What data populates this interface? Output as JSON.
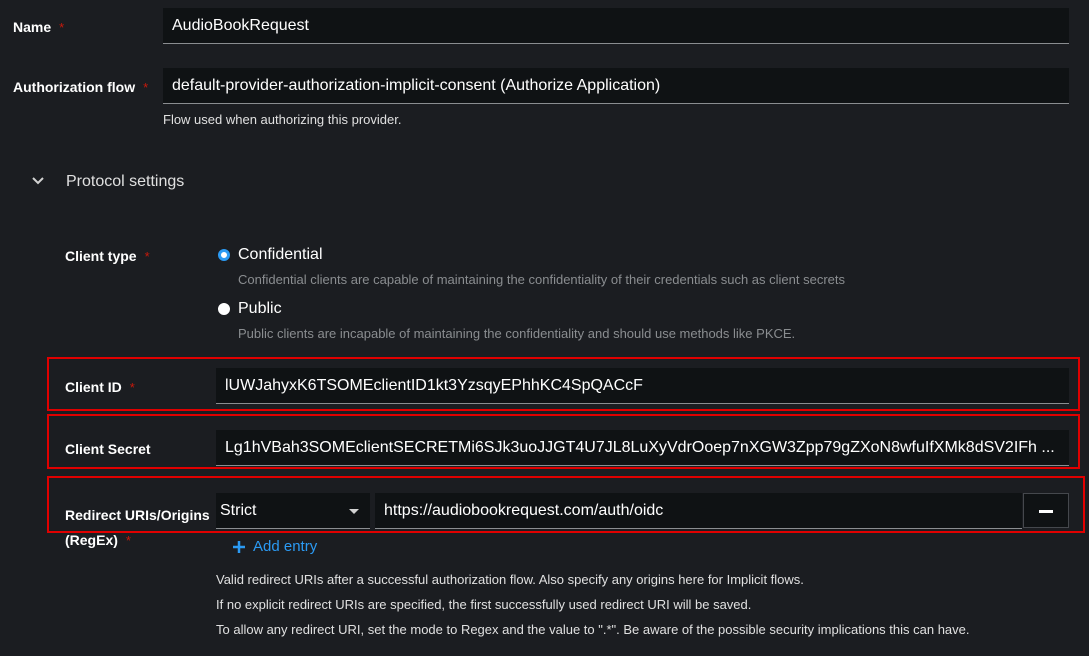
{
  "name": {
    "label": "Name",
    "required": "*",
    "value": "AudioBookRequest"
  },
  "auth_flow": {
    "label": "Authorization flow",
    "required": "*",
    "value": "default-provider-authorization-implicit-consent (Authorize Application)",
    "helper": "Flow used when authorizing this provider."
  },
  "protocol": {
    "title": "Protocol settings",
    "icon": "chevron-down-icon"
  },
  "client_type": {
    "label": "Client type",
    "required": "*",
    "options": [
      {
        "label": "Confidential",
        "desc": "Confidential clients are capable of maintaining the confidentiality of their credentials such as client secrets",
        "selected": true
      },
      {
        "label": "Public",
        "desc": "Public clients are incapable of maintaining the confidentiality and should use methods like PKCE.",
        "selected": false
      }
    ]
  },
  "client_id": {
    "label": "Client ID",
    "required": "*",
    "value": "lUWJahyxK6TSOMEclientID1kt3YzsqyEPhhKC4SpQACcF"
  },
  "client_secret": {
    "label": "Client Secret",
    "value": "Lg1hVBah3SOMEclientSECRETMi6SJk3uoJJGT4U7JL8LuXyVdrOoep7nXGW3Zpp79gZXoN8wfuIfXMk8dSV2IFh ..."
  },
  "redirect": {
    "label_line1": "Redirect URIs/Origins",
    "label_line2": "(RegEx)",
    "required": "*",
    "mode": "Strict",
    "value": "https://audiobookrequest.com/auth/oidc",
    "add_entry": "Add entry",
    "help": [
      "Valid redirect URIs after a successful authorization flow. Also specify any origins here for Implicit flows.",
      "If no explicit redirect URIs are specified, the first successfully used redirect URI will be saved.",
      "To allow any redirect URI, set the mode to Regex and the value to \".*\". Be aware of the possible security implications this can have."
    ]
  },
  "colors": {
    "accent": "#2b9af3",
    "highlight": "#e00000",
    "required": "#c9190b"
  }
}
